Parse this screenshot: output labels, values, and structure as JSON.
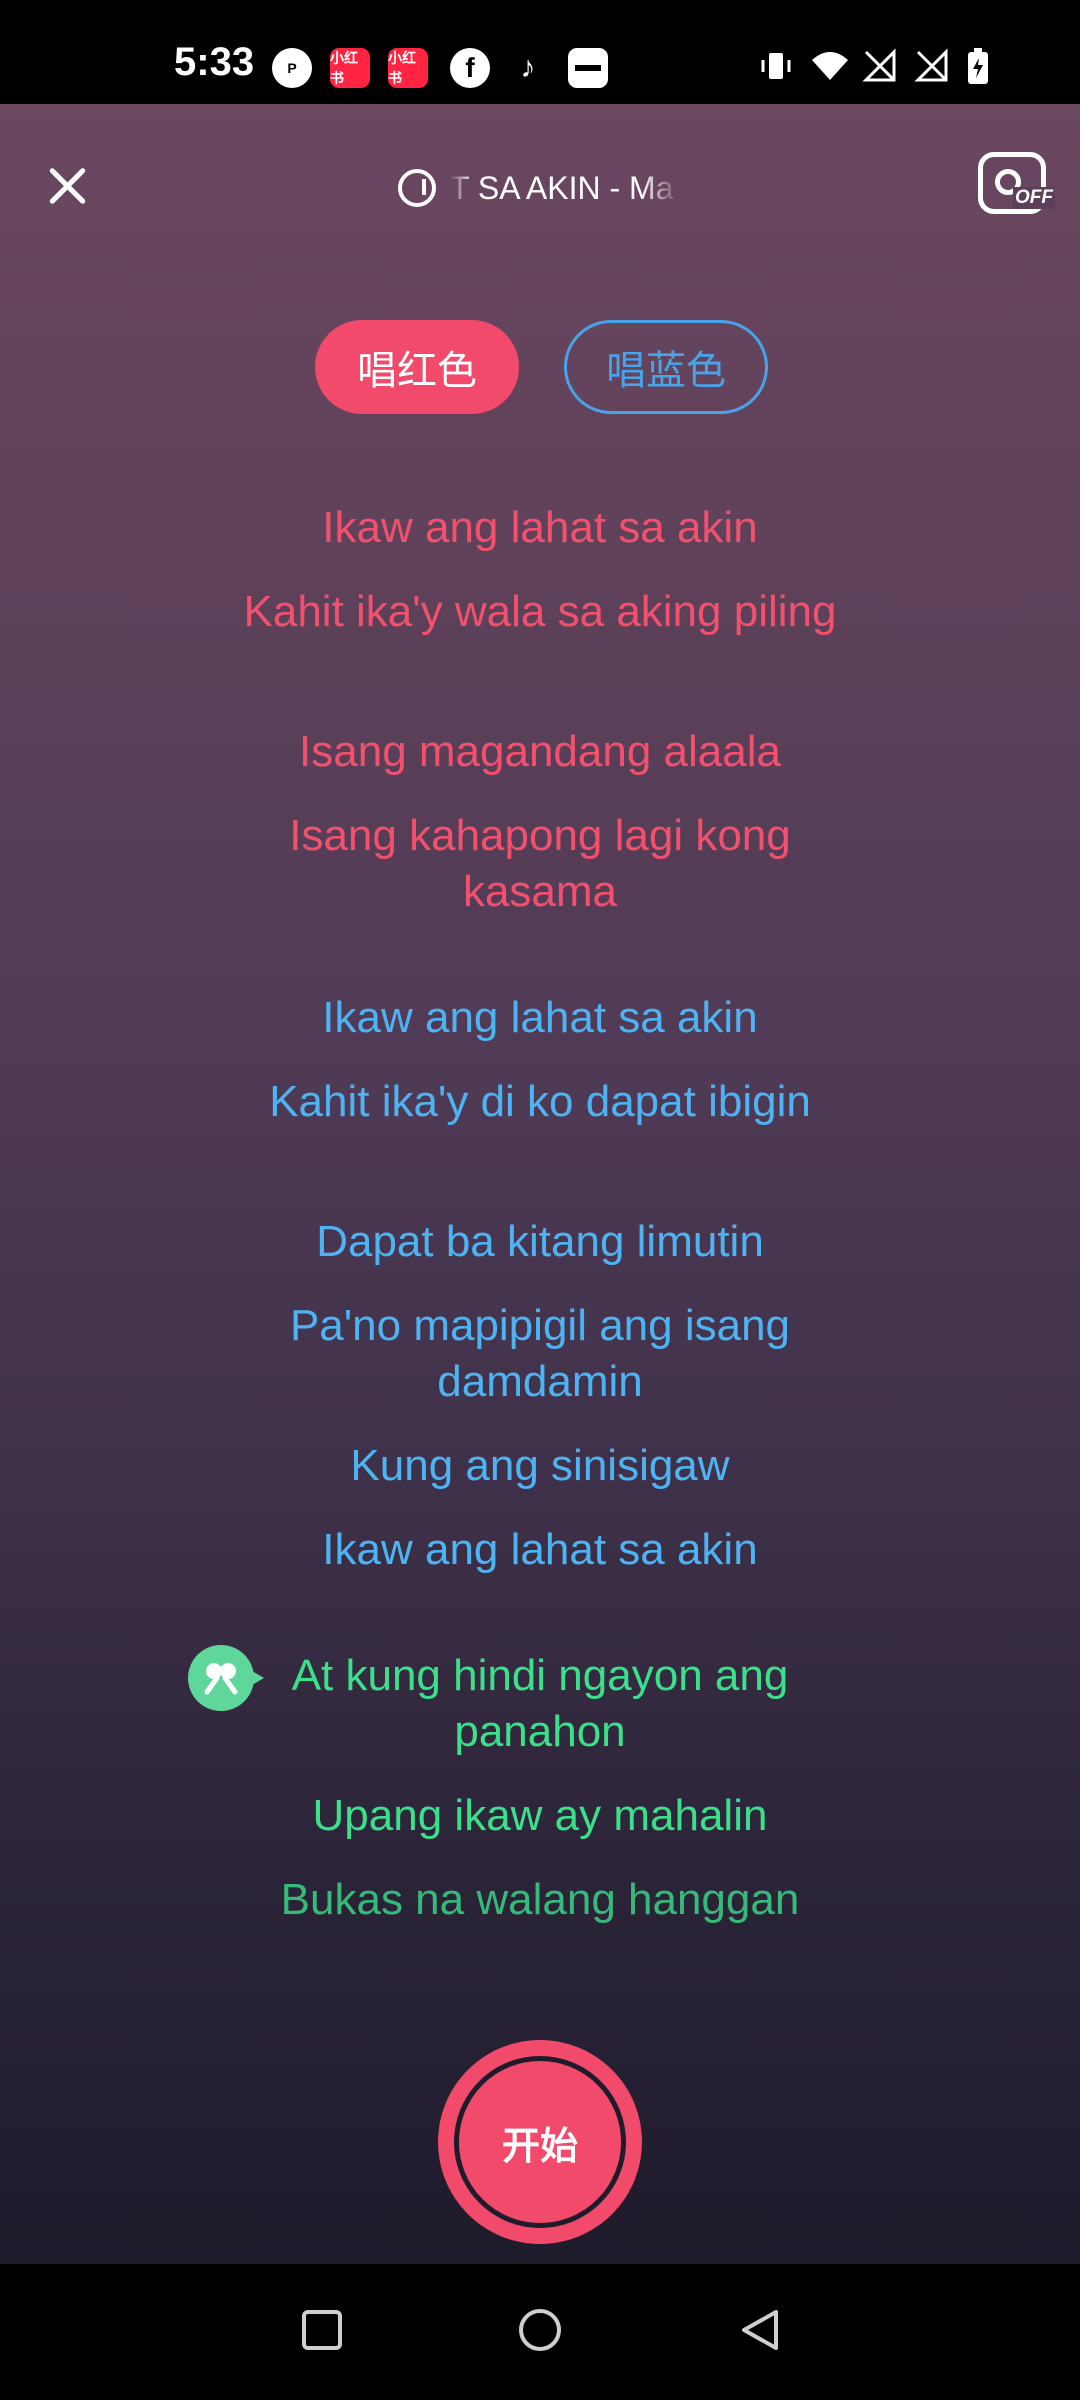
{
  "status_bar": {
    "time": "5:33",
    "app_icons": [
      "p-icon",
      "xiaohongshu-icon",
      "xiaohongshu-icon",
      "facebook-icon",
      "tiktok-icon",
      "wallet-icon"
    ],
    "app_icon_labels": {
      "xhs": "小红书"
    }
  },
  "header": {
    "song_title": "T SA AKIN - Ma"
  },
  "roles": {
    "red_label": "唱红色",
    "blue_label": "唱蓝色"
  },
  "lyrics": {
    "red": [
      "Ikaw ang lahat sa akin",
      "Kahit ika'y wala sa aking piling",
      "Isang magandang alaala",
      "Isang kahapong lagi kong kasama"
    ],
    "blue": [
      "Ikaw ang lahat sa akin",
      "Kahit ika'y di ko dapat ibigin",
      "Dapat ba kitang limutin",
      "Pa'no mapipigil ang isang damdamin",
      "Kung ang sinisigaw",
      "Ikaw ang lahat sa akin"
    ],
    "green": [
      "At kung hindi ngayon ang panahon",
      "Upang ikaw ay mahalin",
      "Bukas na walang hanggan"
    ]
  },
  "start_button": {
    "label": "开始"
  },
  "colors": {
    "red": "#f3506e",
    "blue": "#4db3f2",
    "green": "#3ae08a"
  }
}
